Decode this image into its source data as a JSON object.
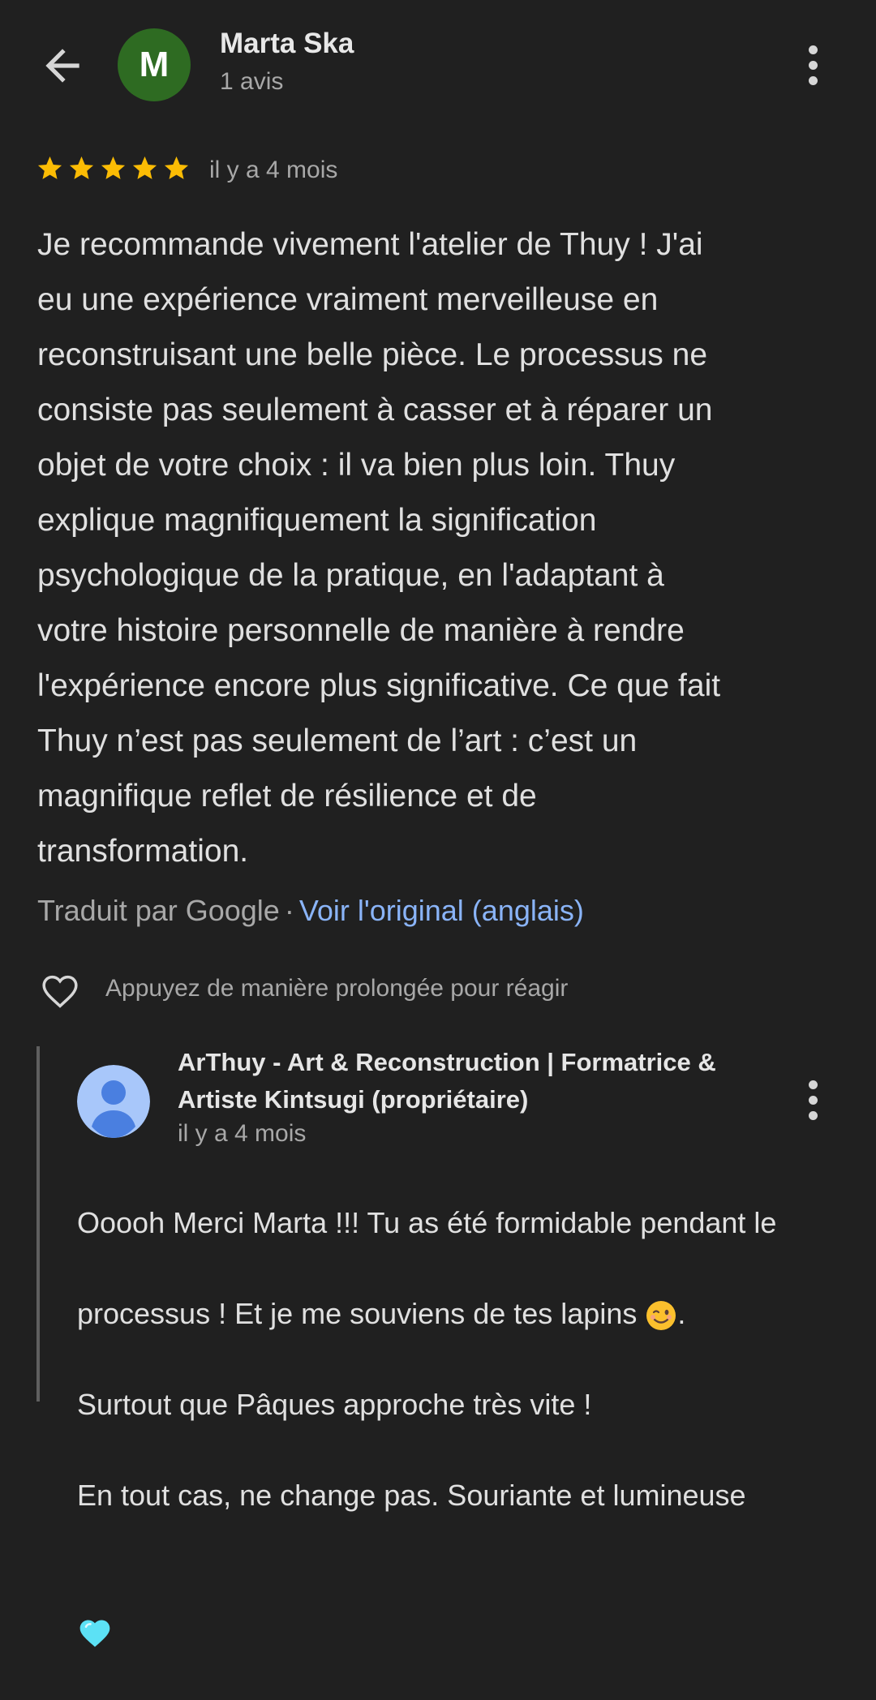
{
  "header": {
    "back_icon": "arrow-left-icon",
    "avatar_letter": "M",
    "avatar_color": "#2e6b22",
    "name": "Marta Ska",
    "subtitle": "1 avis",
    "menu_icon": "more-vert-icon"
  },
  "review": {
    "rating": 5,
    "rating_max": 5,
    "star_color": "#fbbc04",
    "time": "il y a 4 mois",
    "text": "Je recommande vivement l'atelier de Thuy ! J'ai\neu une expérience vraiment merveilleuse en\nreconstruisant une belle pièce. Le processus ne\nconsiste pas seulement à casser et à réparer un\nobjet de votre choix : il va bien plus loin. Thuy\nexplique magnifiquement la signification\npsychologique de la pratique, en l'adaptant à\nvotre histoire personnelle de manière à rendre\nl'expérience encore plus significative. Ce que fait\nThuy n’est pas seulement de l’art : c’est un\nmagnifique reflet de résilience et de\ntransformation.",
    "translated_by": "Traduit par Google",
    "separator": "·",
    "view_original": "Voir l'original (anglais)",
    "link_color": "#8ab4f8",
    "react_hint": "Appuyez de manière prolongée pour réagir",
    "react_icon": "heart-outline-icon"
  },
  "owner_reply": {
    "avatar_icon": "person-avatar-icon",
    "name": "ArThuy - Art & Reconstruction | Formatrice &\nArtiste Kintsugi (propriétaire)",
    "time": "il y a 4 mois",
    "menu_icon": "more-vert-icon",
    "line1": "Ooooh Merci Marta !!! Tu as été formidable pendant le",
    "line2": "processus ! Et je me souviens de tes lapins",
    "line2_emoji": "winking-face-emoji",
    "line2_end": ".",
    "line3": "Surtout que Pâques approche très vite !",
    "line4": "En tout cas, ne change pas. Souriante et lumineuse",
    "line5_emoji": "light-blue-heart-emoji"
  }
}
